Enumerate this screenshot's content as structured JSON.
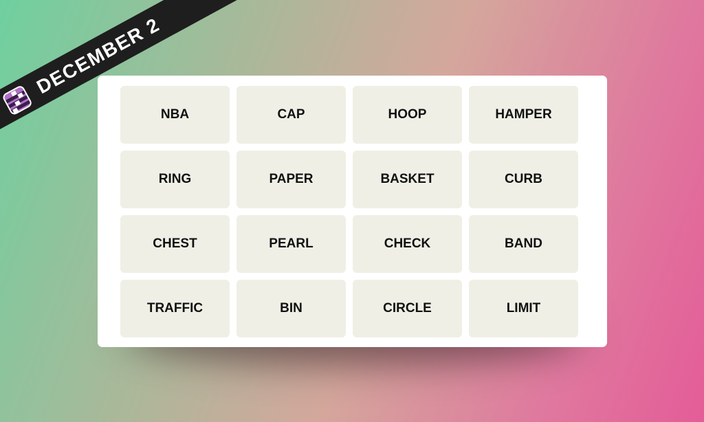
{
  "banner": {
    "date": "DECEMBER 2",
    "icon": "connections-grid-icon",
    "strip_color": "#1e1e1e",
    "icon_color": "#b070c8"
  },
  "board": {
    "tiles": [
      "NBA",
      "CAP",
      "HOOP",
      "HAMPER",
      "RING",
      "PAPER",
      "BASKET",
      "CURB",
      "CHEST",
      "PEARL",
      "CHECK",
      "BAND",
      "TRAFFIC",
      "BIN",
      "CIRCLE",
      "LIMIT"
    ],
    "tile_color": "#efefe6"
  }
}
